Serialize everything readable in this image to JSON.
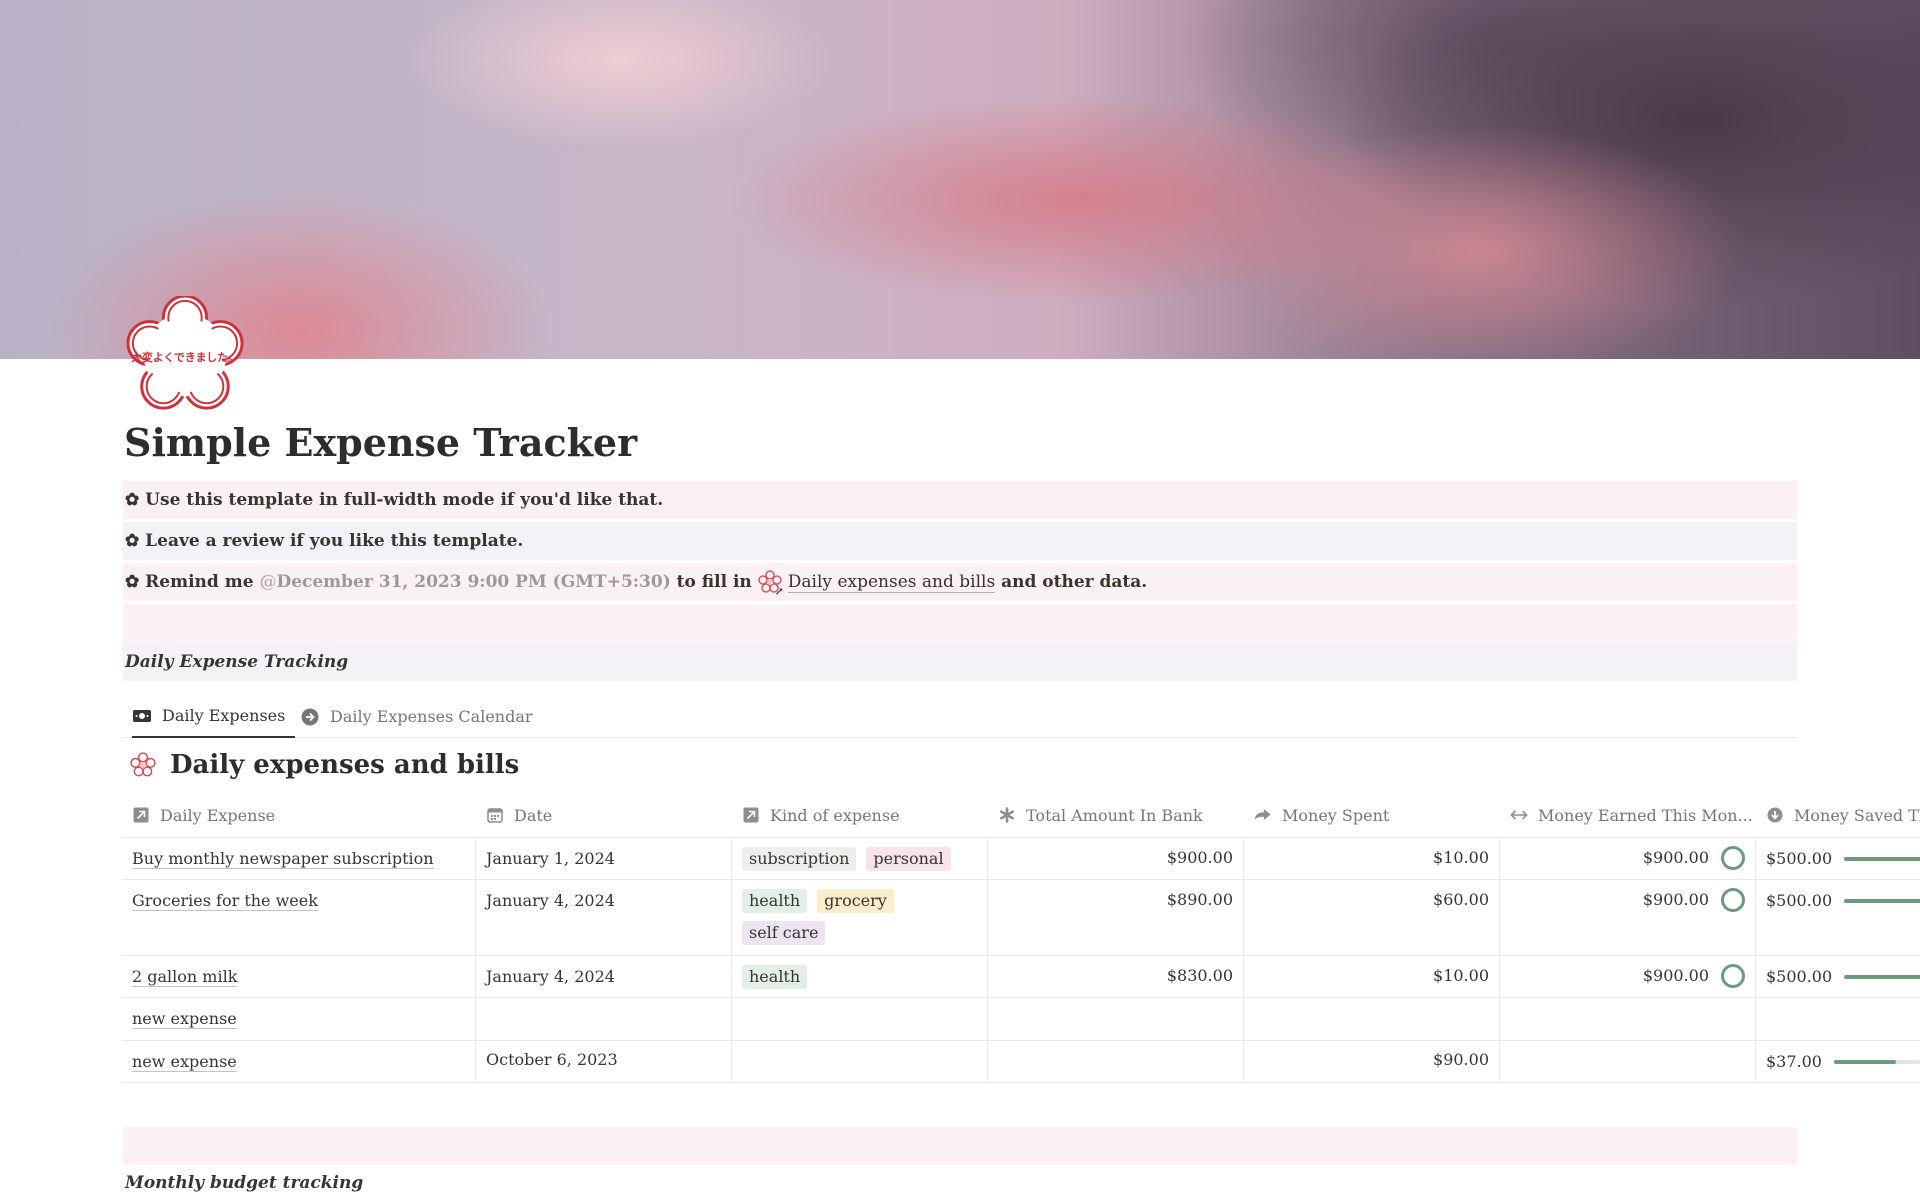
{
  "page": {
    "title": "Simple Expense Tracker",
    "icon": "cherry-blossom-stamp-icon",
    "stamp_text": "大変よくできました。"
  },
  "callouts": [
    {
      "icon": "✿",
      "text": "Use this template in full-width mode if you'd like that."
    },
    {
      "icon": "✿",
      "text": "Leave a review if you like this template."
    },
    {
      "icon": "✿",
      "prefix": "Remind me",
      "mention_at": "@",
      "mention": "December 31, 2023 9:00 PM (GMT+5:30)",
      "middle": "to fill in",
      "link_text": "Daily expenses and bills",
      "suffix": "and other data."
    }
  ],
  "sections": {
    "daily_label": "Daily Expense Tracking",
    "monthly_label": "Monthly budget tracking"
  },
  "tabs": [
    {
      "label": "Daily Expenses",
      "icon": "money-icon",
      "active": true
    },
    {
      "label": "Daily Expenses Calendar",
      "icon": "arrow-right-circle-icon",
      "active": false
    }
  ],
  "database": {
    "title": "Daily expenses and bills",
    "columns": [
      {
        "label": "Daily Expense",
        "icon": "arrow-link-icon"
      },
      {
        "label": "Date",
        "icon": "calendar-icon"
      },
      {
        "label": "Kind of expense",
        "icon": "arrow-link-icon"
      },
      {
        "label": "Total Amount In Bank",
        "icon": "asterisk-icon"
      },
      {
        "label": "Money Spent",
        "icon": "forward-arrow-icon"
      },
      {
        "label": "Money Earned This Mon...",
        "icon": "horizontal-arrows-icon"
      },
      {
        "label": "Money Saved Th",
        "icon": "download-circle-icon"
      }
    ],
    "rows": [
      {
        "name": "Buy monthly newspaper subscription",
        "date": "January 1, 2024",
        "tags": [
          {
            "label": "subscription",
            "color": "gray"
          },
          {
            "label": "personal",
            "color": "pinkt"
          }
        ],
        "bank": "$900.00",
        "spent": "$10.00",
        "earned": "$900.00",
        "earned_ring": true,
        "saved": "$500.00",
        "saved_progress": 1.0
      },
      {
        "name": "Groceries for the week",
        "date": "January 4, 2024",
        "tags": [
          {
            "label": "health",
            "color": "green"
          },
          {
            "label": "grocery",
            "color": "yellow"
          },
          {
            "label": "self care",
            "color": "purple"
          }
        ],
        "bank": "$890.00",
        "spent": "$60.00",
        "earned": "$900.00",
        "earned_ring": true,
        "saved": "$500.00",
        "saved_progress": 1.0
      },
      {
        "name": "2 gallon milk",
        "date": "January 4, 2024",
        "tags": [
          {
            "label": "health",
            "color": "green"
          }
        ],
        "bank": "$830.00",
        "spent": "$10.00",
        "earned": "$900.00",
        "earned_ring": true,
        "saved": "$500.00",
        "saved_progress": 1.0
      },
      {
        "name": "new expense",
        "date": "",
        "tags": [],
        "bank": "",
        "spent": "",
        "earned": "",
        "earned_ring": false,
        "saved": "",
        "saved_progress": null
      },
      {
        "name": "new expense",
        "date": "October 6, 2023",
        "tags": [],
        "bank": "",
        "spent": "$90.00",
        "earned": "",
        "earned_ring": false,
        "saved": "$37.00",
        "saved_progress": 0.72
      }
    ]
  },
  "colors": {
    "callout_pink": "#fbf0f3",
    "callout_lavender": "#f4f2f7",
    "progress_green": "#6b9a7d",
    "stamp_red": "#d32f3a"
  }
}
